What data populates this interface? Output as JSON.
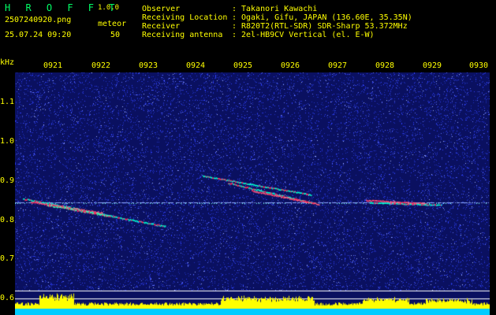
{
  "app": {
    "brand": "H R O F F T",
    "version": "1.0.0",
    "filename": "2507240920.png",
    "datetime": "25.07.24 09:20",
    "meteor_label": "meteor",
    "meteor_count": "50"
  },
  "info": {
    "rows": [
      {
        "key": "Observer",
        "sep": ":",
        "value": "Takanori Kawachi"
      },
      {
        "key": "Receiving Location",
        "sep": ":",
        "value": "Ogaki, Gifu, JAPAN (136.60E, 35.35N)"
      },
      {
        "key": "Receiver",
        "sep": ":",
        "value": "R820T2(RTL-SDR) SDR-Sharp 53.372MHz"
      },
      {
        "key": "Receiving antenna",
        "sep": ":",
        "value": "2el-HB9CV Vertical (el. E-W)"
      }
    ]
  },
  "axes": {
    "y_unit": "kHz",
    "x_ticks": [
      "0921",
      "0922",
      "0923",
      "0924",
      "0925",
      "0926",
      "0927",
      "0928",
      "0929",
      "0930"
    ],
    "y_ticks": [
      "1.1",
      "1.0",
      "0.9",
      "0.8",
      "0.7",
      "0.6"
    ]
  },
  "colors": {
    "background": "#000000",
    "spectrogram_bg": "#0a1060",
    "noise": "#3040ff",
    "label": "#ffff00",
    "header_text": "#00d8a0",
    "trace_cyan": "#00ffd0",
    "trace_red": "#ff3060",
    "level_bar": "#ffff00",
    "level_base": "#00ccff"
  }
}
